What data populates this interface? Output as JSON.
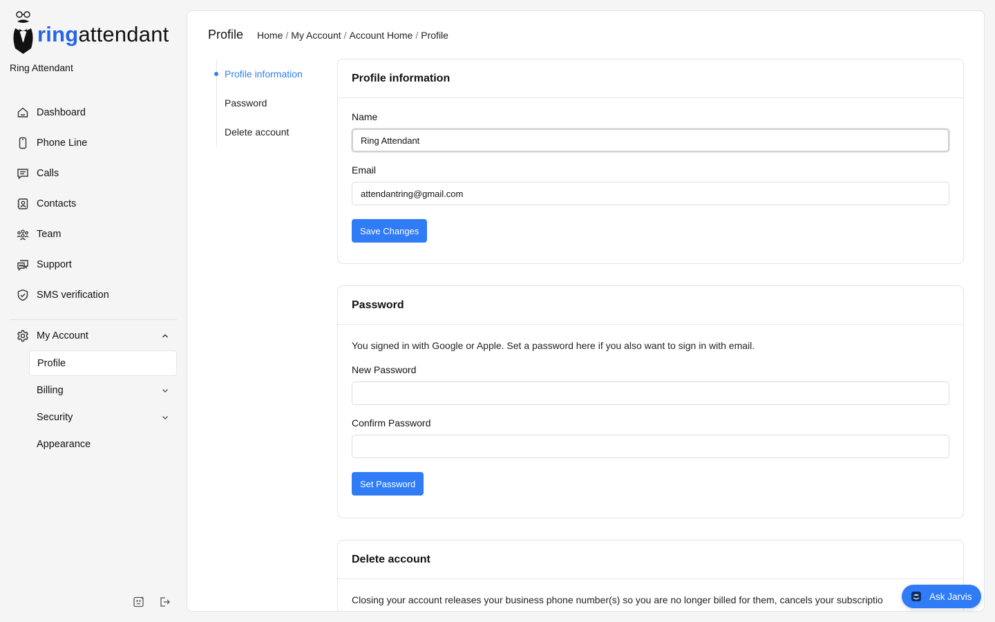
{
  "brand": {
    "logo_ring": "ring",
    "logo_attendant": "attendant",
    "app_name": "Ring Attendant",
    "accent_color": "#2f7cf6"
  },
  "sidebar": {
    "items": [
      {
        "label": "Dashboard",
        "icon": "home-icon"
      },
      {
        "label": "Phone Line",
        "icon": "phone-icon"
      },
      {
        "label": "Calls",
        "icon": "message-icon"
      },
      {
        "label": "Contacts",
        "icon": "contacts-icon"
      },
      {
        "label": "Team",
        "icon": "team-icon"
      },
      {
        "label": "Support",
        "icon": "support-icon"
      },
      {
        "label": "SMS verification",
        "icon": "shield-check-icon"
      }
    ],
    "account": {
      "label": "My Account",
      "icon": "gear-icon",
      "sub_items": [
        {
          "label": "Profile",
          "active": true
        },
        {
          "label": "Billing",
          "expandable": true
        },
        {
          "label": "Security",
          "expandable": true
        },
        {
          "label": "Appearance"
        }
      ]
    }
  },
  "header": {
    "title": "Profile",
    "breadcrumbs": [
      "Home",
      "My Account",
      "Account Home",
      "Profile"
    ]
  },
  "toc": [
    "Profile information",
    "Password",
    "Delete account"
  ],
  "profile_card": {
    "title": "Profile information",
    "name_label": "Name",
    "name_value": "Ring Attendant",
    "email_label": "Email",
    "email_value": "attendantring@gmail.com",
    "save_label": "Save Changes"
  },
  "password_card": {
    "title": "Password",
    "note": "You signed in with Google or Apple. Set a password here if you also want to sign in with email.",
    "new_label": "New Password",
    "new_value": "",
    "confirm_label": "Confirm Password",
    "confirm_value": "",
    "set_label": "Set Password"
  },
  "delete_card": {
    "title": "Delete account",
    "text": "Closing your account releases your business phone number(s) so you are no longer billed for them, cancels your subscriptio"
  },
  "jarvis": {
    "label": "Ask Jarvis"
  }
}
